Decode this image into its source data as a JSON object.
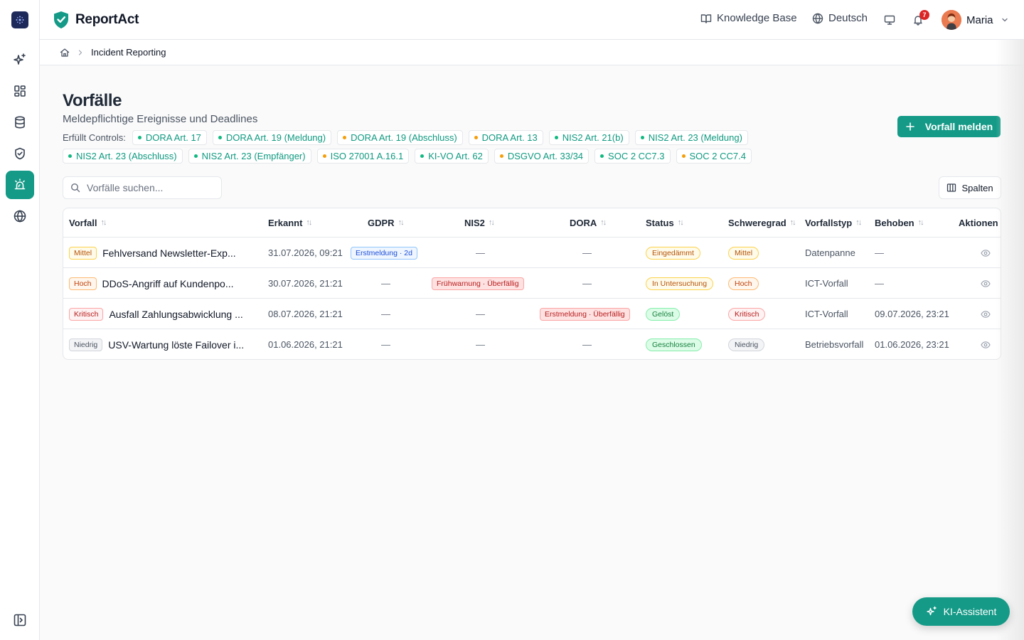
{
  "app": {
    "name": "ReportAct"
  },
  "header": {
    "knowledge_base": "Knowledge Base",
    "language": "Deutsch",
    "notifications_count": "7",
    "user_name": "Maria"
  },
  "breadcrumb": {
    "current": "Incident Reporting"
  },
  "page": {
    "title": "Vorfälle",
    "subtitle": "Meldepflichtige Ereignisse und Deadlines",
    "controls_label": "Erfüllt Controls:",
    "controls": [
      {
        "label": "DORA Art. 17",
        "color": "#10b981"
      },
      {
        "label": "DORA Art. 19 (Meldung)",
        "color": "#10b981"
      },
      {
        "label": "DORA Art. 19 (Abschluss)",
        "color": "#f59e0b"
      },
      {
        "label": "DORA Art. 13",
        "color": "#f59e0b"
      },
      {
        "label": "NIS2 Art. 21(b)",
        "color": "#10b981"
      },
      {
        "label": "NIS2 Art. 23 (Meldung)",
        "color": "#10b981"
      },
      {
        "label": "NIS2 Art. 23 (Abschluss)",
        "color": "#10b981"
      },
      {
        "label": "NIS2 Art. 23 (Empfänger)",
        "color": "#10b981"
      },
      {
        "label": "ISO 27001 A.16.1",
        "color": "#f59e0b"
      },
      {
        "label": "KI-VO Art. 62",
        "color": "#10b981"
      },
      {
        "label": "DSGVO Art. 33/34",
        "color": "#f59e0b"
      },
      {
        "label": "SOC 2 CC7.3",
        "color": "#10b981"
      },
      {
        "label": "SOC 2 CC7.4",
        "color": "#f59e0b"
      }
    ],
    "report_button": "Vorfall melden",
    "search_placeholder": "Vorfälle suchen...",
    "columns_button": "Spalten"
  },
  "table": {
    "columns": {
      "vorfall": "Vorfall",
      "erkannt": "Erkannt",
      "gdpr": "GDPR",
      "nis2": "NIS2",
      "dora": "DORA",
      "status": "Status",
      "schweregrad": "Schweregrad",
      "vorfallstyp": "Vorfallstyp",
      "behoben": "Behoben",
      "aktionen": "Aktionen"
    },
    "rows": [
      {
        "severity": "Mittel",
        "title": "Fehlversand Newsletter-Exp...",
        "erkannt": "31.07.2026, 09:21",
        "gdpr": "Erstmeldung · 2d",
        "nis2": "—",
        "dora": "—",
        "status": "Eingedämmt",
        "schweregrad": "Mittel",
        "vorfallstyp": "Datenpanne",
        "behoben": "—"
      },
      {
        "severity": "Hoch",
        "title": "DDoS-Angriff auf Kundenpo...",
        "erkannt": "30.07.2026, 21:21",
        "gdpr": "—",
        "nis2": "Frühwarnung · Überfällig",
        "dora": "—",
        "status": "In Untersuchung",
        "schweregrad": "Hoch",
        "vorfallstyp": "ICT-Vorfall",
        "behoben": "—"
      },
      {
        "severity": "Kritisch",
        "title": "Ausfall Zahlungsabwicklung ...",
        "erkannt": "08.07.2026, 21:21",
        "gdpr": "—",
        "nis2": "—",
        "dora": "Erstmeldung · Überfällig",
        "status": "Gelöst",
        "schweregrad": "Kritisch",
        "vorfallstyp": "ICT-Vorfall",
        "behoben": "09.07.2026, 23:21"
      },
      {
        "severity": "Niedrig",
        "title": "USV-Wartung löste Failover i...",
        "erkannt": "01.06.2026, 21:21",
        "gdpr": "—",
        "nis2": "—",
        "dora": "—",
        "status": "Geschlossen",
        "schweregrad": "Niedrig",
        "vorfallstyp": "Betriebsvorfall",
        "behoben": "01.06.2026, 23:21"
      }
    ]
  },
  "assistant": {
    "label": "KI-Assistent"
  },
  "colors": {
    "brand": "#149a87",
    "sidebar_logo": "#1e2a5a",
    "mittel": "#b45309",
    "hoch": "#c2410c",
    "kritisch": "#b91c1c",
    "niedrig": "#4b5563",
    "gdpr_badge": "#1d4ed8",
    "overdue_badge": "#b91c1c",
    "geloest": "#15803d"
  }
}
